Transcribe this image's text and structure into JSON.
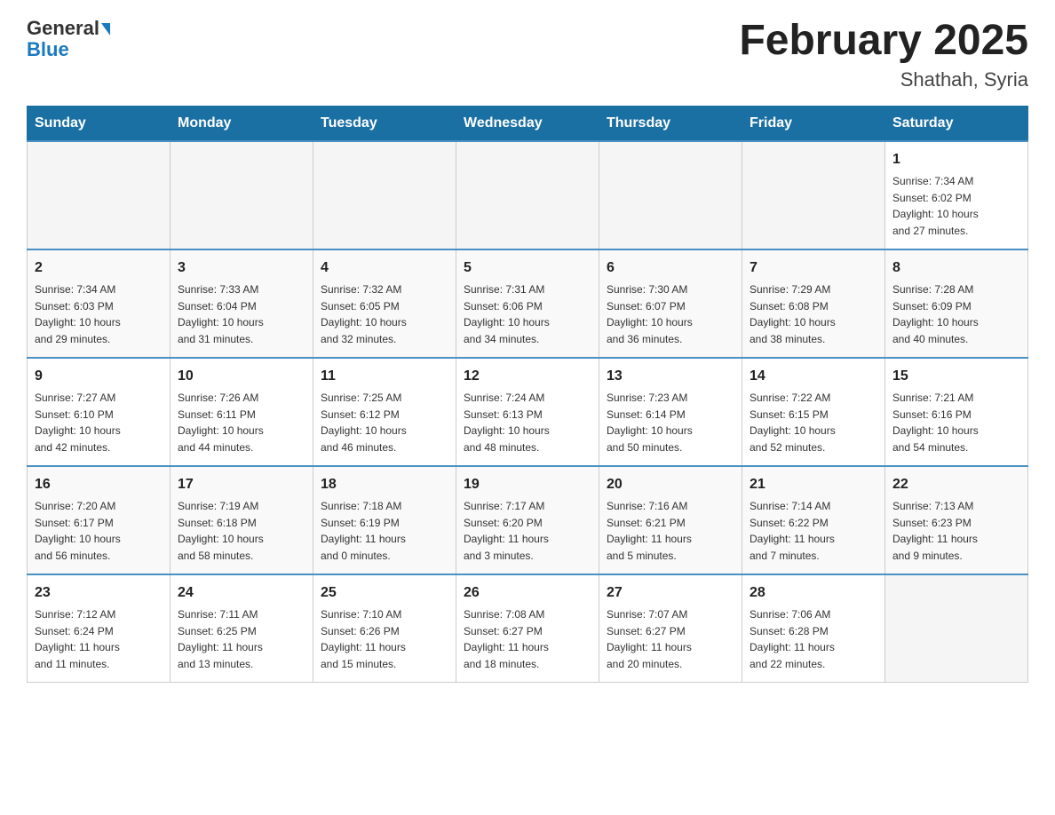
{
  "header": {
    "logo_line1": "General",
    "logo_line2": "Blue",
    "title": "February 2025",
    "subtitle": "Shathah, Syria"
  },
  "days_of_week": [
    "Sunday",
    "Monday",
    "Tuesday",
    "Wednesday",
    "Thursday",
    "Friday",
    "Saturday"
  ],
  "weeks": [
    [
      {
        "day": "",
        "info": ""
      },
      {
        "day": "",
        "info": ""
      },
      {
        "day": "",
        "info": ""
      },
      {
        "day": "",
        "info": ""
      },
      {
        "day": "",
        "info": ""
      },
      {
        "day": "",
        "info": ""
      },
      {
        "day": "1",
        "info": "Sunrise: 7:34 AM\nSunset: 6:02 PM\nDaylight: 10 hours\nand 27 minutes."
      }
    ],
    [
      {
        "day": "2",
        "info": "Sunrise: 7:34 AM\nSunset: 6:03 PM\nDaylight: 10 hours\nand 29 minutes."
      },
      {
        "day": "3",
        "info": "Sunrise: 7:33 AM\nSunset: 6:04 PM\nDaylight: 10 hours\nand 31 minutes."
      },
      {
        "day": "4",
        "info": "Sunrise: 7:32 AM\nSunset: 6:05 PM\nDaylight: 10 hours\nand 32 minutes."
      },
      {
        "day": "5",
        "info": "Sunrise: 7:31 AM\nSunset: 6:06 PM\nDaylight: 10 hours\nand 34 minutes."
      },
      {
        "day": "6",
        "info": "Sunrise: 7:30 AM\nSunset: 6:07 PM\nDaylight: 10 hours\nand 36 minutes."
      },
      {
        "day": "7",
        "info": "Sunrise: 7:29 AM\nSunset: 6:08 PM\nDaylight: 10 hours\nand 38 minutes."
      },
      {
        "day": "8",
        "info": "Sunrise: 7:28 AM\nSunset: 6:09 PM\nDaylight: 10 hours\nand 40 minutes."
      }
    ],
    [
      {
        "day": "9",
        "info": "Sunrise: 7:27 AM\nSunset: 6:10 PM\nDaylight: 10 hours\nand 42 minutes."
      },
      {
        "day": "10",
        "info": "Sunrise: 7:26 AM\nSunset: 6:11 PM\nDaylight: 10 hours\nand 44 minutes."
      },
      {
        "day": "11",
        "info": "Sunrise: 7:25 AM\nSunset: 6:12 PM\nDaylight: 10 hours\nand 46 minutes."
      },
      {
        "day": "12",
        "info": "Sunrise: 7:24 AM\nSunset: 6:13 PM\nDaylight: 10 hours\nand 48 minutes."
      },
      {
        "day": "13",
        "info": "Sunrise: 7:23 AM\nSunset: 6:14 PM\nDaylight: 10 hours\nand 50 minutes."
      },
      {
        "day": "14",
        "info": "Sunrise: 7:22 AM\nSunset: 6:15 PM\nDaylight: 10 hours\nand 52 minutes."
      },
      {
        "day": "15",
        "info": "Sunrise: 7:21 AM\nSunset: 6:16 PM\nDaylight: 10 hours\nand 54 minutes."
      }
    ],
    [
      {
        "day": "16",
        "info": "Sunrise: 7:20 AM\nSunset: 6:17 PM\nDaylight: 10 hours\nand 56 minutes."
      },
      {
        "day": "17",
        "info": "Sunrise: 7:19 AM\nSunset: 6:18 PM\nDaylight: 10 hours\nand 58 minutes."
      },
      {
        "day": "18",
        "info": "Sunrise: 7:18 AM\nSunset: 6:19 PM\nDaylight: 11 hours\nand 0 minutes."
      },
      {
        "day": "19",
        "info": "Sunrise: 7:17 AM\nSunset: 6:20 PM\nDaylight: 11 hours\nand 3 minutes."
      },
      {
        "day": "20",
        "info": "Sunrise: 7:16 AM\nSunset: 6:21 PM\nDaylight: 11 hours\nand 5 minutes."
      },
      {
        "day": "21",
        "info": "Sunrise: 7:14 AM\nSunset: 6:22 PM\nDaylight: 11 hours\nand 7 minutes."
      },
      {
        "day": "22",
        "info": "Sunrise: 7:13 AM\nSunset: 6:23 PM\nDaylight: 11 hours\nand 9 minutes."
      }
    ],
    [
      {
        "day": "23",
        "info": "Sunrise: 7:12 AM\nSunset: 6:24 PM\nDaylight: 11 hours\nand 11 minutes."
      },
      {
        "day": "24",
        "info": "Sunrise: 7:11 AM\nSunset: 6:25 PM\nDaylight: 11 hours\nand 13 minutes."
      },
      {
        "day": "25",
        "info": "Sunrise: 7:10 AM\nSunset: 6:26 PM\nDaylight: 11 hours\nand 15 minutes."
      },
      {
        "day": "26",
        "info": "Sunrise: 7:08 AM\nSunset: 6:27 PM\nDaylight: 11 hours\nand 18 minutes."
      },
      {
        "day": "27",
        "info": "Sunrise: 7:07 AM\nSunset: 6:27 PM\nDaylight: 11 hours\nand 20 minutes."
      },
      {
        "day": "28",
        "info": "Sunrise: 7:06 AM\nSunset: 6:28 PM\nDaylight: 11 hours\nand 22 minutes."
      },
      {
        "day": "",
        "info": ""
      }
    ]
  ]
}
